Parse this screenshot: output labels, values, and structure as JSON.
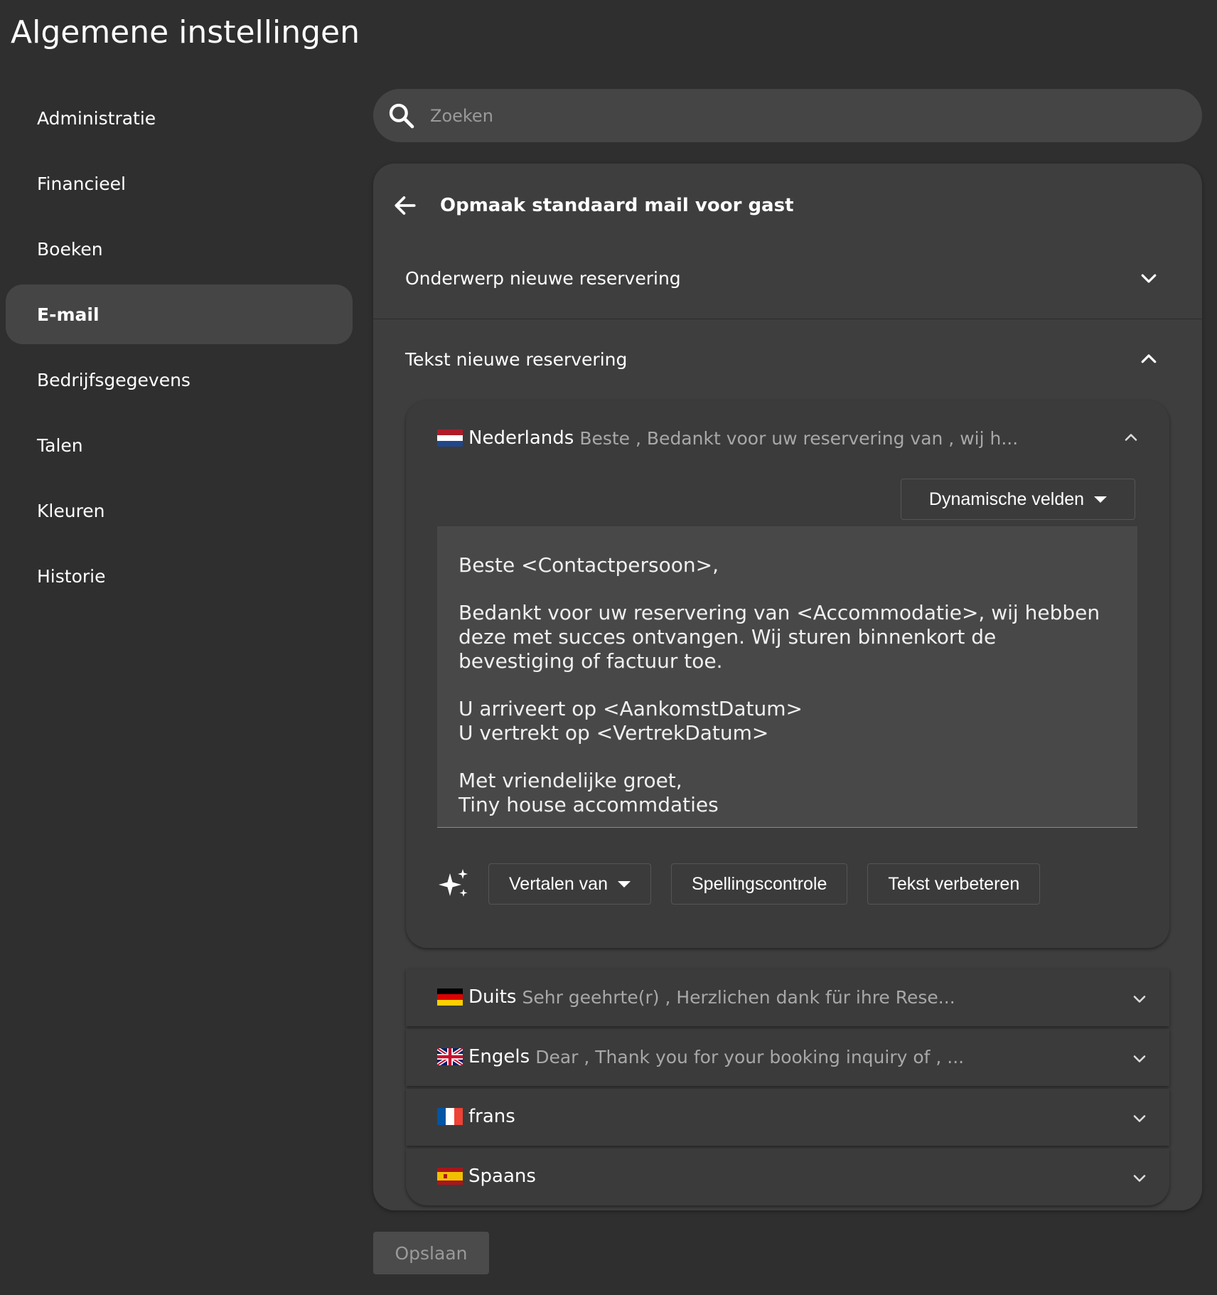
{
  "page": {
    "title": "Algemene instellingen"
  },
  "sidebar": {
    "items": [
      {
        "label": "Administratie",
        "active": false
      },
      {
        "label": "Financieel",
        "active": false
      },
      {
        "label": "Boeken",
        "active": false
      },
      {
        "label": "E-mail",
        "active": true
      },
      {
        "label": "Bedrijfsgegevens",
        "active": false
      },
      {
        "label": "Talen",
        "active": false
      },
      {
        "label": "Kleuren",
        "active": false
      },
      {
        "label": "Historie",
        "active": false
      }
    ]
  },
  "search": {
    "placeholder": "Zoeken",
    "value": ""
  },
  "panel": {
    "title": "Opmaak standaard mail voor gast",
    "sections": [
      {
        "label": "Onderwerp nieuwe reservering",
        "expanded": false
      },
      {
        "label": "Tekst nieuwe reservering",
        "expanded": true
      }
    ]
  },
  "languages": {
    "open": {
      "name": "Nederlands",
      "preview": "Beste , Bedankt voor uw reservering van , wij h...",
      "flag": "nl",
      "dynamic_fields_label": "Dynamische velden",
      "body": {
        "line1": "Beste <Contactpersoon>,",
        "line2": "Bedankt voor uw reservering van <Accommodatie>, wij hebben deze met succes ontvangen. Wij sturen binnenkort de bevestiging of factuur toe.",
        "line3": "U arriveert op <AankomstDatum>",
        "line4": "U vertrekt op <VertrekDatum>",
        "line5": "Met vriendelijke groet,",
        "line6": "Tiny house accommdaties"
      },
      "tools": {
        "translate_label": "Vertalen van",
        "spellcheck_label": "Spellingscontrole",
        "improve_label": "Tekst verbeteren"
      }
    },
    "closed": [
      {
        "name": "Duits",
        "preview": "Sehr geehrte(r) , Herzlichen dank für ihre Rese...",
        "flag": "de"
      },
      {
        "name": "Engels",
        "preview": "Dear , Thank you for your booking inquiry of , ...",
        "flag": "gb"
      },
      {
        "name": "frans",
        "preview": "",
        "flag": "fr"
      },
      {
        "name": "Spaans",
        "preview": "",
        "flag": "es"
      }
    ]
  },
  "footer": {
    "save_label": "Opslaan",
    "save_disabled": true
  },
  "colors": {
    "background": "#2f2f2f",
    "panel": "#3e3e3e",
    "active_item": "#454545",
    "editor": "#484848",
    "muted_text": "#a8a8a8"
  }
}
